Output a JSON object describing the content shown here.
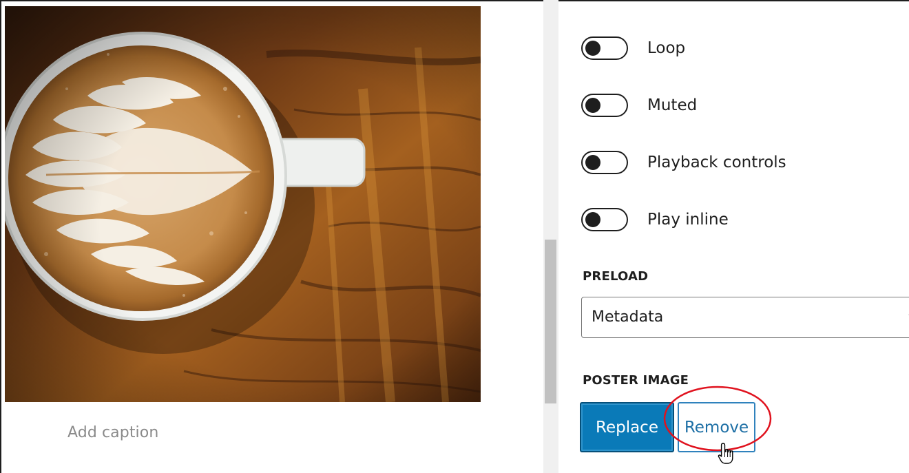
{
  "editor": {
    "caption_placeholder": "Add caption",
    "poster_image_subject": "latte-art-coffee-cup"
  },
  "settings": {
    "toggles": [
      {
        "label": "Loop",
        "enabled": false
      },
      {
        "label": "Muted",
        "enabled": false
      },
      {
        "label": "Playback controls",
        "enabled": false
      },
      {
        "label": "Play inline",
        "enabled": false
      }
    ],
    "preload": {
      "heading": "PRELOAD",
      "selected": "Metadata"
    },
    "poster_image": {
      "heading": "POSTER IMAGE",
      "replace_label": "Replace",
      "remove_label": "Remove"
    }
  },
  "colors": {
    "primary_button": "#0a7ab8",
    "link_blue": "#1d6fa5",
    "highlight_red": "#e0121e",
    "toggle_dark": "#1e1e1e"
  },
  "icons": {
    "select_arrow": "chevron-down-icon",
    "cursor": "pointing-hand-cursor-icon"
  }
}
